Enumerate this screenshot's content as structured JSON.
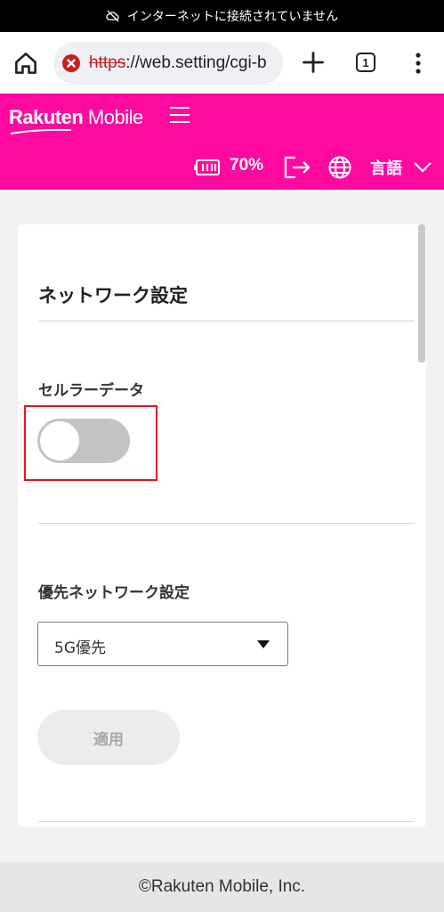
{
  "status_bar": {
    "text": "インターネットに接続されていません",
    "icon": "cloud-off-icon"
  },
  "browser": {
    "url_scheme": "https",
    "url_rest": "://web.setting/cgi-b",
    "tab_count": "1",
    "icons": [
      "home-icon",
      "not-secure-icon",
      "plus-icon",
      "tab-switcher-icon",
      "more-vert-icon"
    ]
  },
  "header": {
    "brand_rakuten": "Rakuten",
    "brand_mobile": "Mobile",
    "battery_percent": "70%",
    "language_label": "言語",
    "accent_color": "#ff0aa0"
  },
  "card": {
    "title": "ネットワーク設定",
    "cellular_label": "セルラーデータ",
    "cellular_enabled": false,
    "preferred_label": "優先ネットワーク設定",
    "preferred_value": "5G優先",
    "apply_label": "適用"
  },
  "footer": {
    "copyright": "©Rakuten Mobile, Inc."
  }
}
